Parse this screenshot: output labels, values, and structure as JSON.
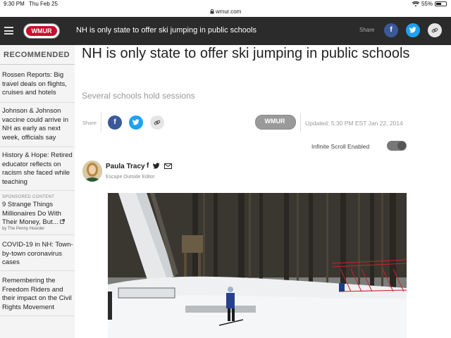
{
  "status_bar": {
    "time": "9:30 PM",
    "day": "Thu Feb 25",
    "url": "wmur.com",
    "battery": "55%",
    "battery_level": 0.55
  },
  "header": {
    "logo": "WMUR",
    "title": "NH is only state to offer ski jumping in public schools",
    "share_label": "Share",
    "share_icons": [
      "facebook-icon",
      "twitter-icon",
      "link-icon"
    ]
  },
  "sidebar": {
    "heading": "RECOMMENDED",
    "items": [
      {
        "text": "Rossen Reports: Big travel deals on flights, cruises and hotels"
      },
      {
        "text": "Johnson & Johnson vaccine could arrive in NH as early as next week, officials say"
      },
      {
        "text": "History & Hope: Retired educator reflects on racism she faced while teaching"
      },
      {
        "sponsored_label": "SPONSORED CONTENT",
        "text": "9 Strange Things Millionaires Do With Their Money, But...",
        "byline": "by The Penny Hoarder"
      },
      {
        "text": "COVID-19 in NH: Town-by-town coronavirus cases"
      },
      {
        "text": "Remembering the Freedom Riders and their impact on the Civil Rights Movement"
      }
    ]
  },
  "article": {
    "title": "NH is only state to offer ski jumping in public schools",
    "subtitle": "Several schools hold sessions",
    "share_label": "Share",
    "station_logo": "WMUR",
    "updated": "Updated: 5:30 PM EST Jan 22, 2014",
    "infinite_scroll_label": "Infinite Scroll Enabled",
    "infinite_scroll_on": true,
    "author": {
      "name": "Paula Tracy",
      "title": "Escape Outside Editor"
    }
  },
  "colors": {
    "header_bg": "#2b2b2b",
    "brand_red": "#c8102e",
    "facebook": "#3b5998",
    "twitter": "#1da1f2"
  }
}
